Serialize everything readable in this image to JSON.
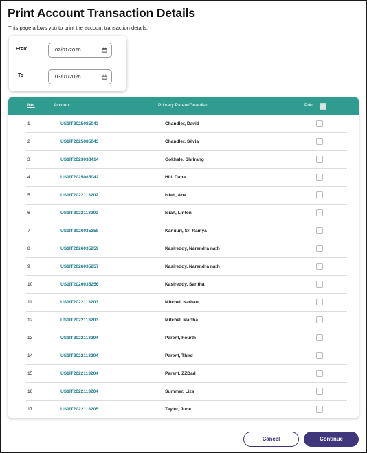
{
  "page": {
    "title": "Print Account Transaction Details",
    "subtitle": "This page allows you to print the account transaction details."
  },
  "filters": {
    "from_label": "From",
    "from_value": "02/01/2026",
    "to_label": "To",
    "to_value": "03/01/2026"
  },
  "table": {
    "headers": {
      "no": "No.",
      "account": "Account",
      "guardian": "Primary Parent/Guardian",
      "print": "Print"
    },
    "rows": [
      {
        "no": "1",
        "account": "US1IT2025085043",
        "guardian": "Chandler, David"
      },
      {
        "no": "2",
        "account": "US1IT2025085043",
        "guardian": "Chandler, Silvia"
      },
      {
        "no": "3",
        "account": "US1IT2023033414",
        "guardian": "Gokhale, Shrirang"
      },
      {
        "no": "4",
        "account": "US1IT2025085042",
        "guardian": "Hill, Dana"
      },
      {
        "no": "5",
        "account": "US1IT2022113202",
        "guardian": "Isiah, Ana"
      },
      {
        "no": "6",
        "account": "US1IT2022113202",
        "guardian": "Isiah, Linton"
      },
      {
        "no": "7",
        "account": "US1IT2026035258",
        "guardian": "Kanuuri, Sri Ramya"
      },
      {
        "no": "8",
        "account": "US1IT2026035259",
        "guardian": "Kasireddy, Narendra nath"
      },
      {
        "no": "9",
        "account": "US1IT2026035257",
        "guardian": "Kasireddy, Narendra nath"
      },
      {
        "no": "10",
        "account": "US1IT2026035256",
        "guardian": "Kasireddy, Saritha"
      },
      {
        "no": "11",
        "account": "US1IT2022113203",
        "guardian": "Mitchel, Nathan"
      },
      {
        "no": "12",
        "account": "US1IT2022113203",
        "guardian": "Mitchel, Martha"
      },
      {
        "no": "13",
        "account": "US1IT2022113204",
        "guardian": "Parent, Fourth"
      },
      {
        "no": "14",
        "account": "US1IT2022113204",
        "guardian": "Parent, Third"
      },
      {
        "no": "15",
        "account": "US1IT2022113204",
        "guardian": "Parent, ZZDad"
      },
      {
        "no": "16",
        "account": "US1IT2022113204",
        "guardian": "Summer, Liza"
      },
      {
        "no": "17",
        "account": "US1IT2022113205",
        "guardian": "Taylor, Jude"
      }
    ]
  },
  "actions": {
    "cancel_label": "Cancel",
    "continue_label": "Continue"
  },
  "colors": {
    "header_bg": "#2f9c8f",
    "account_link": "#1d7a8a",
    "primary_button": "#3f367c"
  },
  "icons": {
    "date": "calendar-icon"
  }
}
